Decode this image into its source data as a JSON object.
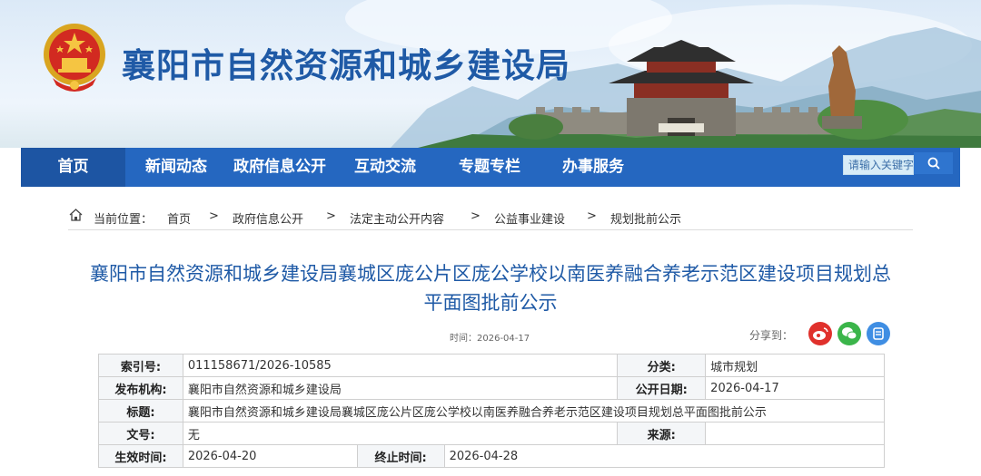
{
  "header": {
    "site_title": "襄阳市自然资源和城乡建设局"
  },
  "nav": {
    "items": [
      "首页",
      "新闻动态",
      "政府信息公开",
      "互动交流",
      "专题专栏",
      "办事服务"
    ],
    "search_placeholder": "请输入关键字",
    "search_icon": "search-icon"
  },
  "breadcrumb": {
    "prefix": "当前位置：",
    "items": [
      "首页",
      "政府信息公开",
      "法定主动公开内容",
      "公益事业建设",
      "规划批前公示"
    ],
    "separator": ">"
  },
  "article": {
    "title": "襄阳市自然资源和城乡建设局襄城区庞公片区庞公学校以南医养融合养老示范区建设项目规划总平面图批前公示",
    "date_label": "时间：2026-04-17",
    "share_label": "分享到："
  },
  "share": {
    "icons": [
      "weibo-icon",
      "wechat-icon",
      "qzone-icon"
    ],
    "colors": [
      "#e0312c",
      "#3bb54a",
      "#3f8ee3"
    ]
  },
  "info_table": {
    "index_label": "索引号:",
    "index_value": "011158671/2026-10585",
    "category_label": "分类:",
    "category_value": "城市规划",
    "publisher_label": "发布机构:",
    "publisher_value": "襄阳市自然资源和城乡建设局",
    "publish_date_label": "公开日期:",
    "publish_date_value": "2026-04-17",
    "title_label": "标题:",
    "title_value": "襄阳市自然资源和城乡建设局襄城区庞公片区庞公学校以南医养融合养老示范区建设项目规划总平面图批前公示",
    "doc_no_label": "文号:",
    "doc_no_value": "无",
    "source_label": "来源:",
    "source_value": "",
    "effective_label": "生效时间:",
    "effective_value": "2026-04-20",
    "expiry_label": "终止时间:",
    "expiry_value": "2026-04-28"
  },
  "colors": {
    "brand_blue": "#2567c0",
    "title_blue": "#1f5aa6"
  }
}
